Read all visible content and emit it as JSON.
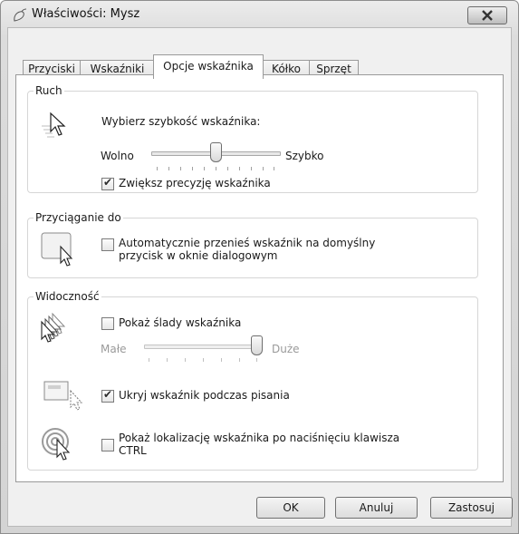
{
  "window": {
    "title": "Właściwości: Mysz",
    "icon": "mouse-icon",
    "close_icon": "close-icon"
  },
  "tabs": [
    {
      "label": "Przyciski",
      "active": false
    },
    {
      "label": "Wskaźniki",
      "active": false
    },
    {
      "label": "Opcje wskaźnika",
      "active": true
    },
    {
      "label": "Kółko",
      "active": false
    },
    {
      "label": "Sprzęt",
      "active": false
    }
  ],
  "motion": {
    "legend": "Ruch",
    "speed_label": "Wybierz szybkość wskaźnika:",
    "slow_label": "Wolno",
    "fast_label": "Szybko",
    "speed_value_fraction": 0.5,
    "precision_label": "Zwiększ precyzję wskaźnika",
    "precision_checked": true
  },
  "snap_to": {
    "legend": "Przyciąganie do",
    "checkbox_label_line1": "Automatycznie przenieś wskaźnik na domyślny",
    "checkbox_label_line2": "przycisk w oknie dialogowym",
    "checked": false
  },
  "visibility": {
    "legend": "Widoczność",
    "trails_label": "Pokaż ślady wskaźnika",
    "trails_checked": false,
    "short_label": "Małe",
    "long_label": "Duże",
    "trails_value_fraction": 1.0,
    "hide_label": "Ukryj wskaźnik podczas pisania",
    "hide_checked": true,
    "ctrl_label_line1": "Pokaż lokalizację wskaźnika po naciśnięciu klawisza",
    "ctrl_label_line2": "CTRL",
    "ctrl_checked": false
  },
  "buttons": {
    "ok": "OK",
    "cancel": "Anuluj",
    "apply": "Zastosuj"
  }
}
